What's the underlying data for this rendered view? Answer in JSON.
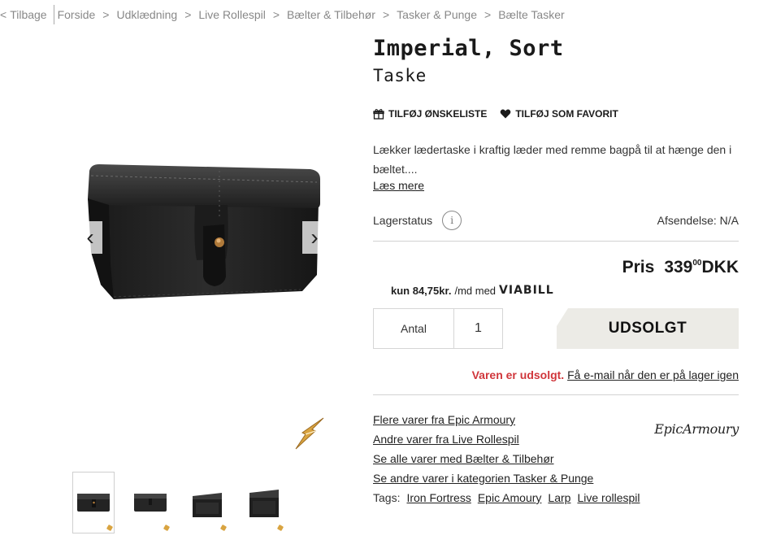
{
  "breadcrumb": {
    "back_label": "Tilbage",
    "items": [
      "Forside",
      "Udklædning",
      "Live Rollespil",
      "Bælter & Tilbehør",
      "Tasker & Punge",
      "Bælte Tasker"
    ]
  },
  "product": {
    "title": "Imperial, Sort",
    "subtitle": "Taske",
    "wishlist_label": "TILFØJ ØNSKELISTE",
    "favorite_label": "TILFØJ SOM FAVORIT",
    "description": "Lækker lædertaske i kraftig læder med remme bagpå til at hænge den i bæltet....",
    "read_more": "Læs mere",
    "stock_label": "Lagerstatus",
    "info_icon_glyph": "i",
    "shipping": "Afsendelse: N/A",
    "price_label": "Pris",
    "price_whole": "339",
    "price_decimals": "00",
    "currency": "DKK",
    "viabill_amount": "kun 84,75kr.",
    "viabill_text": "/md med",
    "viabill_logo": "VIABILL",
    "quantity_label": "Antal",
    "quantity_value": "1",
    "soldout_button": "UDSOLGT",
    "soldout_text": "Varen er udsolgt.",
    "notify_link": "Få e-mail når den er på lager igen"
  },
  "links": [
    "Flere varer fra Epic Armoury",
    "Andre varer fra Live Rollespil",
    "Se alle varer med Bælter & Tilbehør",
    "Se andre varer i kategorien Tasker & Punge"
  ],
  "brand_logo": "EpicArmoury",
  "tags": {
    "label": "Tags:",
    "items": [
      "Iron Fortress",
      "Epic Amoury",
      "Larp",
      "Live rollespil"
    ]
  },
  "gallery": {
    "prev_glyph": "‹",
    "next_glyph": "›",
    "thumbnail_count": 4
  },
  "colors": {
    "soldout_red": "#d0363b",
    "soldout_button_bg": "#ecebe6",
    "text_dark": "#1a1a1a",
    "breadcrumb_grey": "#888888"
  },
  "icons": [
    "chevron-left-icon",
    "gift-icon",
    "heart-icon",
    "info-icon",
    "arrow-left-icon",
    "arrow-right-icon"
  ]
}
